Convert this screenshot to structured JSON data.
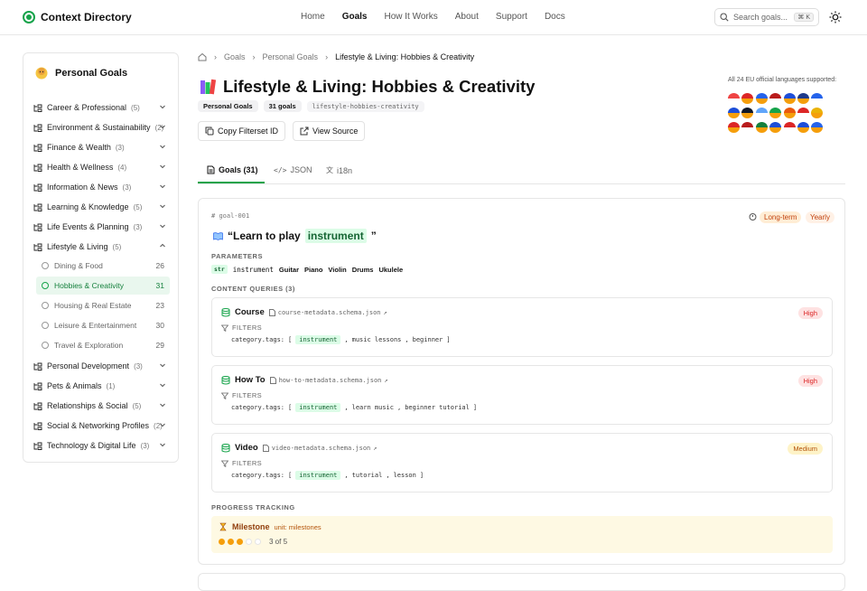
{
  "brand": {
    "name": "Context Directory",
    "accent": "#16a34a"
  },
  "nav": [
    {
      "label": "Home",
      "active": false
    },
    {
      "label": "Goals",
      "active": true
    },
    {
      "label": "How It Works",
      "active": false
    },
    {
      "label": "About",
      "active": false
    },
    {
      "label": "Support",
      "active": false
    },
    {
      "label": "Docs",
      "active": false
    }
  ],
  "search": {
    "placeholder": "Search goals...",
    "shortcut": "⌘ K"
  },
  "sidebar": {
    "title": "Personal Goals",
    "items": [
      {
        "label": "Career & Professional",
        "count": "(5)"
      },
      {
        "label": "Environment & Sustainability",
        "count": "(2)"
      },
      {
        "label": "Finance & Wealth",
        "count": "(3)"
      },
      {
        "label": "Health & Wellness",
        "count": "(4)"
      },
      {
        "label": "Information & News",
        "count": "(3)"
      },
      {
        "label": "Learning & Knowledge",
        "count": "(5)"
      },
      {
        "label": "Life Events & Planning",
        "count": "(3)"
      },
      {
        "label": "Lifestyle & Living",
        "count": "(5)",
        "expanded": true
      },
      {
        "label": "Personal Development",
        "count": "(3)"
      },
      {
        "label": "Pets & Animals",
        "count": "(1)"
      },
      {
        "label": "Relationships & Social",
        "count": "(5)"
      },
      {
        "label": "Social & Networking Profiles",
        "count": "(2)"
      },
      {
        "label": "Technology & Digital Life",
        "count": "(3)"
      }
    ],
    "subitems": [
      {
        "label": "Dining & Food",
        "count": "26"
      },
      {
        "label": "Hobbies & Creativity",
        "count": "31",
        "active": true
      },
      {
        "label": "Housing & Real Estate",
        "count": "23"
      },
      {
        "label": "Leisure & Entertainment",
        "count": "30"
      },
      {
        "label": "Travel & Exploration",
        "count": "29"
      }
    ]
  },
  "breadcrumb": [
    "Goals",
    "Personal Goals",
    "Lifestyle & Living: Hobbies & Creativity"
  ],
  "page": {
    "title": "Lifestyle & Living: Hobbies & Creativity",
    "badge_category": "Personal Goals",
    "badge_count": "31 goals",
    "badge_slug": "lifestyle-hobbies-creativity",
    "copy_label": "Copy Filterset ID",
    "source_label": "View Source",
    "languages_note": "All 24 EU official languages supported:"
  },
  "tabs": [
    {
      "label": "Goals (31)",
      "active": true
    },
    {
      "label": "JSON",
      "active": false
    },
    {
      "label": "i18n",
      "active": false
    }
  ],
  "goal": {
    "id": "goal-001",
    "pill_term": "Long-term",
    "pill_freq": "Yearly",
    "title_prefix": "“Learn to play",
    "title_highlight": "instrument",
    "title_suffix": "”",
    "params_label": "PARAMETERS",
    "param_type": "str",
    "param_name": "instrument",
    "param_values": [
      "Guitar",
      "Piano",
      "Violin",
      "Drums",
      "Ukulele"
    ],
    "queries_label": "CONTENT QUERIES (3)",
    "queries": [
      {
        "type": "Course",
        "schema": "course-metadata.schema.json",
        "priority": "High",
        "filters_label": "FILTERS",
        "field": "category.tags:",
        "tags": [
          "instrument",
          "music lessons",
          "beginner"
        ]
      },
      {
        "type": "How To",
        "schema": "how-to-metadata.schema.json",
        "priority": "High",
        "filters_label": "FILTERS",
        "field": "category.tags:",
        "tags": [
          "instrument",
          "learn music",
          "beginner tutorial"
        ]
      },
      {
        "type": "Video",
        "schema": "video-metadata.schema.json",
        "priority": "Medium",
        "filters_label": "FILTERS",
        "field": "category.tags:",
        "tags": [
          "instrument",
          "tutorial",
          "lesson"
        ]
      }
    ],
    "progress_label": "PROGRESS TRACKING",
    "milestone_label": "Milestone",
    "milestone_unit": "unit: milestones",
    "progress_text": "3 of 5",
    "progress_done": 3,
    "progress_total": 5
  }
}
